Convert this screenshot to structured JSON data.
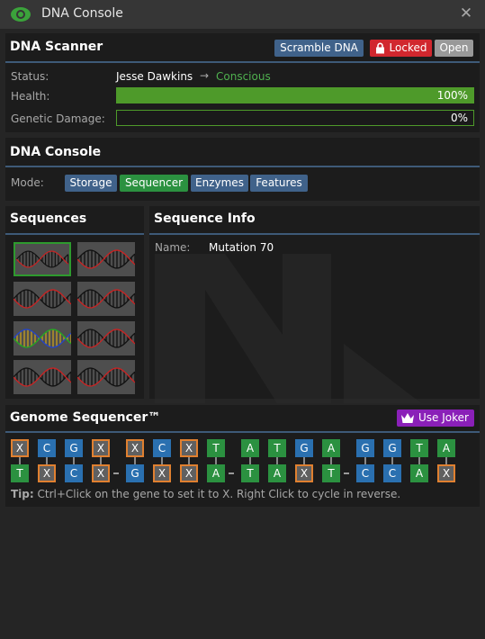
{
  "window": {
    "title": "DNA Console",
    "close_glyph": "✕"
  },
  "scanner": {
    "title": "DNA Scanner",
    "scramble_label": "Scramble DNA",
    "locked_label": "Locked",
    "open_label": "Open",
    "status_label": "Status:",
    "subject_name": "Jesse Dawkins",
    "arrow": "→",
    "subject_state": "Conscious",
    "health_label": "Health:",
    "health_value": 1.0,
    "health_text": "100%",
    "damage_label": "Genetic Damage:",
    "damage_value": 0.0,
    "damage_text": "0%"
  },
  "console": {
    "title": "DNA Console",
    "mode_label": "Mode:",
    "modes": [
      "Storage",
      "Sequencer",
      "Enzymes",
      "Features"
    ],
    "active_mode": "Sequencer"
  },
  "sequences": {
    "title": "Sequences",
    "selected_index": 0
  },
  "info": {
    "title": "Sequence Info",
    "name_label": "Name:",
    "name_value": "Mutation 70"
  },
  "genome": {
    "title": "Genome Sequencer™",
    "joker_label": "Use Joker",
    "top": [
      "X",
      "C",
      "G",
      "X",
      "X",
      "C",
      "X",
      "T",
      "A",
      "T",
      "G",
      "A",
      "G",
      "G",
      "T",
      "A"
    ],
    "bottom": [
      "T",
      "X",
      "C",
      "X",
      "G",
      "X",
      "X",
      "A",
      "T",
      "A",
      "X",
      "T",
      "C",
      "C",
      "A",
      "X"
    ],
    "tip_bold": "Tip:",
    "tip_text": " Ctrl+Click on the gene to set it to X. Right Click to cycle in reverse."
  },
  "colors": {
    "accent_blue": "#40628a",
    "selected_green": "#2b9140",
    "locked_red": "#d1272e",
    "health_green": "#4e9a2a",
    "joker_purple": "#8a20b8",
    "gene_x_border": "#e08030"
  },
  "icons": {
    "title_icon": "eye-icon",
    "locked_icon": "lock-icon",
    "joker_icon": "crown-icon"
  }
}
